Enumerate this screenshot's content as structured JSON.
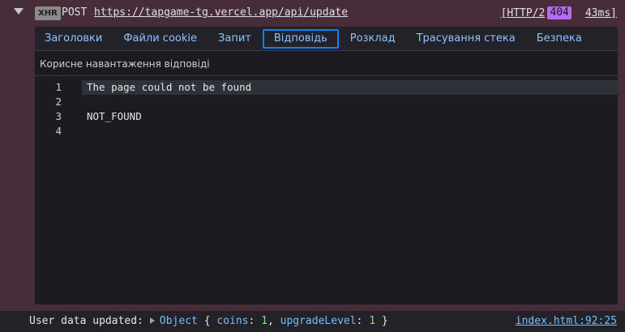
{
  "request": {
    "type_badge": "XHR",
    "method": "POST",
    "url": "https://tapgame-tg.vercel.app/api/update",
    "protocol": "[HTTP/2",
    "status_code": "404",
    "duration": "43ms]"
  },
  "tabs": [
    {
      "label": "Заголовки",
      "selected": false
    },
    {
      "label": "Файли cookie",
      "selected": false
    },
    {
      "label": "Запит",
      "selected": false
    },
    {
      "label": "Відповідь",
      "selected": true
    },
    {
      "label": "Розклад",
      "selected": false
    },
    {
      "label": "Трасування стека",
      "selected": false
    },
    {
      "label": "Безпека",
      "selected": false
    }
  ],
  "response_panel": {
    "title": "Корисне навантаження відповіді",
    "lines": [
      {
        "number": "1",
        "text": "The page could not be found"
      },
      {
        "number": "2",
        "text": ""
      },
      {
        "number": "3",
        "text": "NOT_FOUND"
      },
      {
        "number": "4",
        "text": ""
      }
    ]
  },
  "console": {
    "message_prefix": "User data updated:",
    "object_label": "Object",
    "open_brace": "{",
    "key1": "coins",
    "value1": "1",
    "key2": "upgradeLevel",
    "value2": "1",
    "close_brace": "}",
    "source": "index.html:92:25"
  },
  "colors": {
    "accent": "#0a84ff",
    "status_badge": "#b56cf0",
    "link": "#75bfff",
    "number": "#86de74"
  }
}
